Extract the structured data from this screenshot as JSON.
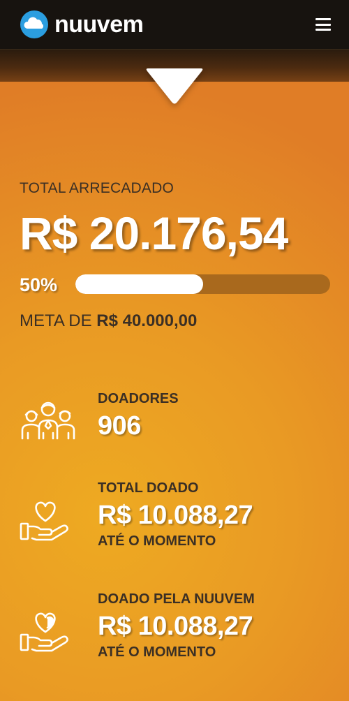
{
  "header": {
    "logo_text": "nuuvem",
    "logo_icon": "cloud-icon",
    "menu_icon": "hamburger-menu-icon"
  },
  "campaign": {
    "total_label": "TOTAL ARRECADADO",
    "total_value": "R$ 20.176,54",
    "progress_percent_text": "50%",
    "progress_fraction": 0.5,
    "goal_prefix": "META DE ",
    "goal_value": "R$ 40.000,00"
  },
  "stats": [
    {
      "icon": "donors-group-icon",
      "label": "DOADORES",
      "value": "906",
      "sub": ""
    },
    {
      "icon": "heart-in-hand-icon",
      "label": "TOTAL DOADO",
      "value": "R$ 10.088,27",
      "sub": "ATÉ O MOMENTO"
    },
    {
      "icon": "heart-gift-hand-icon",
      "label": "DOADO PELA NUUVEM",
      "value": "R$ 10.088,27",
      "sub": "ATÉ O MOMENTO"
    }
  ],
  "colors": {
    "navbar": "#17130f",
    "accent_orange": "#e99a24",
    "text_dark": "#3b2f24",
    "progress_track": "#a9691d",
    "white": "#ffffff"
  }
}
